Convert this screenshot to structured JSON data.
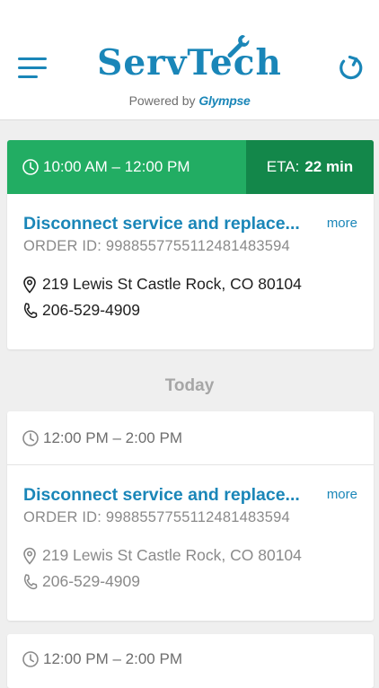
{
  "header": {
    "logo_text": "ServTech",
    "powered_prefix": "Powered by",
    "powered_brand": "Glympse"
  },
  "active_job": {
    "time_window": "10:00 AM – 12:00 PM",
    "eta_label": "ETA:",
    "eta_value": "22 min",
    "title": "Disconnect service and replace...",
    "more_label": "more",
    "order_id": "ORDER ID: 998855775511248148359​4",
    "address": "219 Lewis St Castle Rock, CO 80104",
    "phone": "206-529-4909"
  },
  "section": {
    "label": "Today"
  },
  "jobs": [
    {
      "time_window": "12:00 PM – 2:00 PM",
      "title": "Disconnect service and replace...",
      "more_label": "more",
      "order_id": "ORDER ID: 9988557755112481483594",
      "address": "219 Lewis St Castle Rock, CO 80104",
      "phone": "206-529-4909"
    },
    {
      "time_window": "12:00 PM – 2:00 PM"
    }
  ],
  "colors": {
    "brand_blue": "#1a86b8",
    "active_green": "#22ad63",
    "eta_green": "#13874a",
    "background": "#efefef"
  },
  "icons": {
    "menu": "menu-icon",
    "refresh": "refresh-icon",
    "clock": "clock-icon",
    "location": "location-pin-icon",
    "phone": "phone-icon"
  }
}
